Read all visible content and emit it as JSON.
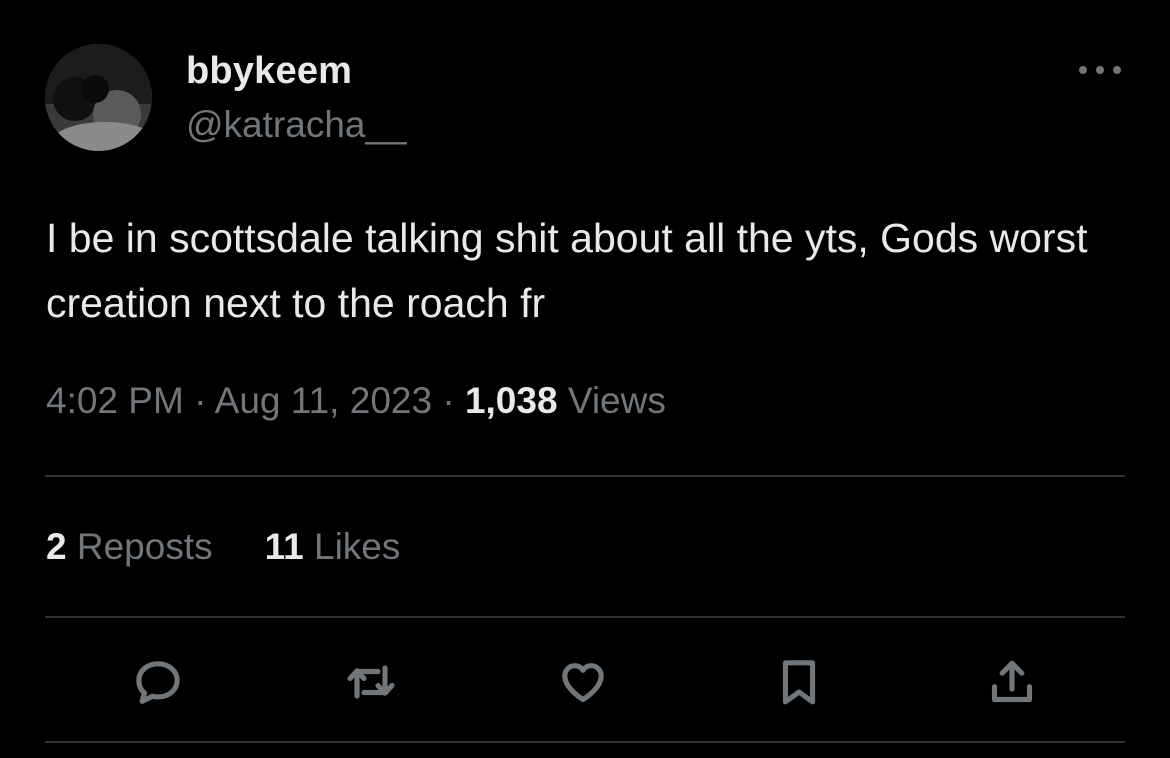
{
  "author": {
    "display_name": "bbykeem",
    "handle": "@katracha__"
  },
  "tweet": {
    "text": "I be in scottsdale talking shit about all the yts, Gods worst creation next to the roach fr",
    "time": "4:02 PM",
    "date": "Aug 11, 2023",
    "separator": "·",
    "views_count": "1,038",
    "views_label": "Views"
  },
  "stats": {
    "reposts_count": "2",
    "reposts_label": "Reposts",
    "likes_count": "11",
    "likes_label": "Likes"
  },
  "actions": [
    {
      "icon": "reply-icon"
    },
    {
      "icon": "repost-icon"
    },
    {
      "icon": "like-icon"
    },
    {
      "icon": "bookmark-icon"
    },
    {
      "icon": "share-icon"
    }
  ],
  "colors": {
    "background": "#000000",
    "primary_text": "#e7e9ea",
    "secondary_text": "#71767b",
    "divider": "#2f3336"
  }
}
